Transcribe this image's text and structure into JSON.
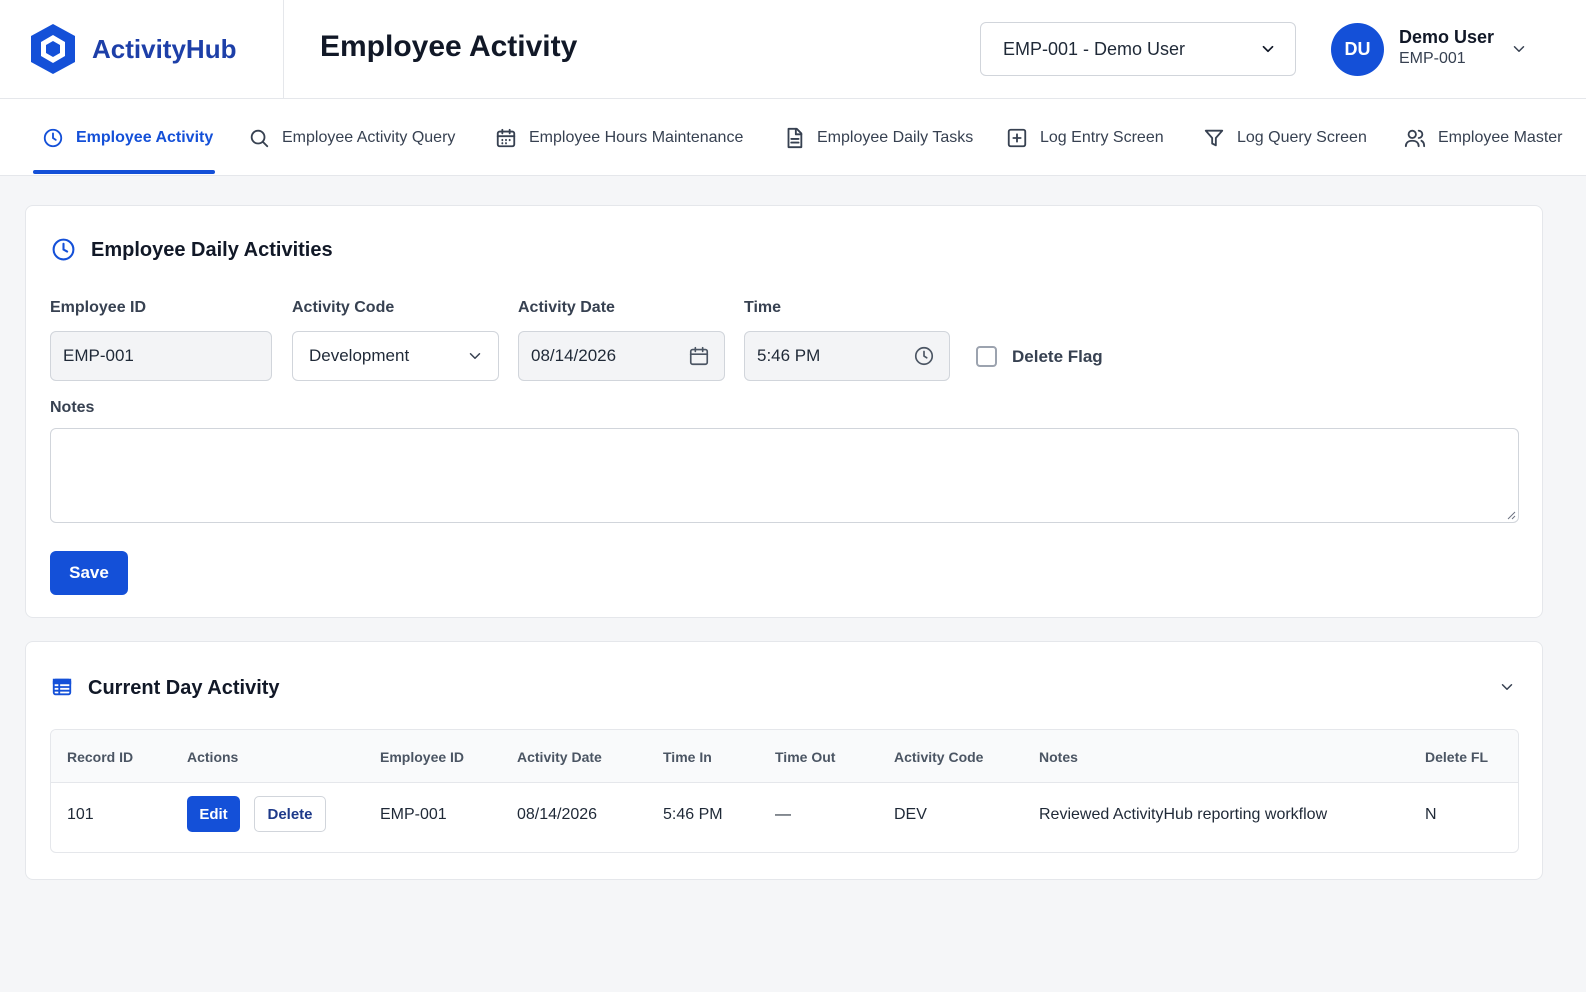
{
  "header": {
    "brand_name": "ActivityHub",
    "page_title": "Employee Activity",
    "employee_selector": "EMP-001 - Demo User",
    "user": {
      "initials": "DU",
      "name": "Demo User",
      "id": "EMP-001"
    }
  },
  "tabs": [
    {
      "label": "Employee Activity",
      "icon": "clock-icon",
      "active": true
    },
    {
      "label": "Employee Activity Query",
      "icon": "search-icon",
      "active": false
    },
    {
      "label": "Employee Hours Maintenance",
      "icon": "calendar-icon",
      "active": false
    },
    {
      "label": "Employee Daily Tasks",
      "icon": "document-icon",
      "active": false
    },
    {
      "label": "Log Entry Screen",
      "icon": "plus-square-icon",
      "active": false
    },
    {
      "label": "Log Query Screen",
      "icon": "filter-icon",
      "active": false
    },
    {
      "label": "Employee Master",
      "icon": "users-icon",
      "active": false
    }
  ],
  "form": {
    "title": "Employee Daily Activities",
    "employee_id": {
      "label": "Employee ID",
      "value": "EMP-001"
    },
    "activity_code": {
      "label": "Activity Code",
      "value": "Development"
    },
    "activity_date": {
      "label": "Activity Date",
      "value": "08/14/2026"
    },
    "time": {
      "label": "Time",
      "value": "5:46 PM"
    },
    "delete_flag": {
      "label": "Delete Flag",
      "checked": false
    },
    "notes": {
      "label": "Notes",
      "value": ""
    },
    "save_label": "Save"
  },
  "current_day": {
    "title": "Current Day Activity",
    "columns": [
      "Record ID",
      "Actions",
      "Employee ID",
      "Activity Date",
      "Time In",
      "Time Out",
      "Activity Code",
      "Notes",
      "Delete FL"
    ],
    "rows": [
      {
        "record_id": "101",
        "edit_label": "Edit",
        "delete_label": "Delete",
        "employee_id": "EMP-001",
        "activity_date": "08/14/2026",
        "time_in": "5:46 PM",
        "time_out": "—",
        "activity_code": "DEV",
        "notes": "Reviewed ActivityHub reporting workflow",
        "delete_fl": "N"
      }
    ]
  },
  "colors": {
    "primary": "#1450d8",
    "brand": "#1d3fa8",
    "background": "#f5f6f8"
  }
}
